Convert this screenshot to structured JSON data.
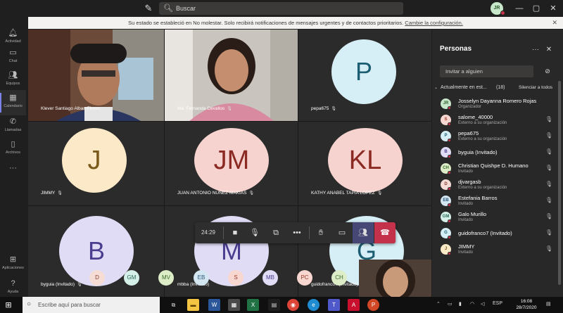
{
  "titlebar": {
    "search_placeholder": "Buscar",
    "me_initials": "JR"
  },
  "rail": [
    {
      "label": "Actividad",
      "icon": "bell-icon"
    },
    {
      "label": "Chat",
      "icon": "chat-icon"
    },
    {
      "label": "Equipos",
      "icon": "teams-icon"
    },
    {
      "label": "Calendario",
      "icon": "calendar-icon"
    },
    {
      "label": "Llamadas",
      "icon": "phone-icon"
    },
    {
      "label": "Archivos",
      "icon": "file-icon"
    },
    {
      "label": "Aplicaciones",
      "icon": "apps-icon"
    },
    {
      "label": "Ayuda",
      "icon": "help-icon"
    }
  ],
  "banner": {
    "text": "Su estado se estableció en No molestar. Solo recibirá notificaciones de mensajes urgentes y de contactos prioritarios.",
    "link": "Cambie la configuración."
  },
  "tiles": [
    {
      "name": "Klever Santiago Alban Flores"
    },
    {
      "name": "Ma. Fernanda Cevallos"
    },
    {
      "name": "pepa675",
      "initials": "P"
    },
    {
      "name": "JIMMY",
      "initials": "J"
    },
    {
      "name": "JUAN ANTONIO NUÑEZ MAKIAS",
      "initials": "JM"
    },
    {
      "name": "KATHY ANABEL TAPIA LOPEZ",
      "initials": "KL"
    },
    {
      "name": "byguia (Invitado)",
      "initials": "B"
    },
    {
      "name": "mbba (Invitado)",
      "initials": "M"
    },
    {
      "name": "guidofranco7 (Invitado)",
      "initials": "G"
    }
  ],
  "overflow_avatars": [
    "D",
    "GM",
    "MV",
    "EB",
    "S",
    "MB",
    "PC",
    "CH"
  ],
  "controls": {
    "timer": "24:29"
  },
  "panel": {
    "title": "Personas",
    "invite_placeholder": "Invitar a alguien",
    "section_label": "Actualmente en est...",
    "section_count": "(18)",
    "mute_all": "Silenciar a todos",
    "people": [
      {
        "initials": "JR",
        "name": "Josselyn Dayanna Romero Rojas",
        "sub": "Organizador",
        "color": "#c8e6c9",
        "fg": "#2e5e2e",
        "mic": false
      },
      {
        "initials": "S",
        "name": "salome_40000",
        "sub": "Externo a su organización",
        "color": "#f8d7d0",
        "fg": "#9a3a2a",
        "mic": true
      },
      {
        "initials": "P",
        "name": "pepa675",
        "sub": "Externo a su organización",
        "color": "#d6eef5",
        "fg": "#1b5e73",
        "mic": true
      },
      {
        "initials": "B",
        "name": "byguia (Invitado)",
        "sub": "",
        "color": "#e1dcf5",
        "fg": "#4a3d8f",
        "mic": true
      },
      {
        "initials": "CH",
        "name": "Christian Quishpe D. Humano",
        "sub": "Invitado",
        "color": "#dcedc8",
        "fg": "#3d6b2a",
        "mic": true
      },
      {
        "initials": "D",
        "name": "djvargasb",
        "sub": "Externo a su organización",
        "color": "#f5ddd5",
        "fg": "#8a3b2b",
        "mic": true
      },
      {
        "initials": "EB",
        "name": "Estefania Barros",
        "sub": "Invitado",
        "color": "#d4e6f1",
        "fg": "#2b5778",
        "mic": true
      },
      {
        "initials": "GM",
        "name": "Galo Murillo",
        "sub": "Invitado",
        "color": "#d5f0e8",
        "fg": "#2a6b57",
        "mic": true
      },
      {
        "initials": "G",
        "name": "guidofranco7 (Invitado)",
        "sub": "",
        "color": "#d6eef5",
        "fg": "#1b5e73",
        "mic": true
      },
      {
        "initials": "J",
        "name": "JIMMY",
        "sub": "Invitado",
        "color": "#fbe9c8",
        "fg": "#7a5a1a",
        "mic": true
      }
    ]
  },
  "taskbar": {
    "search_placeholder": "Escribe aquí para buscar",
    "lang": "ESP",
    "time": "16:08",
    "date": "28/7/2020"
  },
  "colors": {
    "accent": "#464775",
    "hangup": "#c4314b",
    "dnd": "#c4314b"
  }
}
